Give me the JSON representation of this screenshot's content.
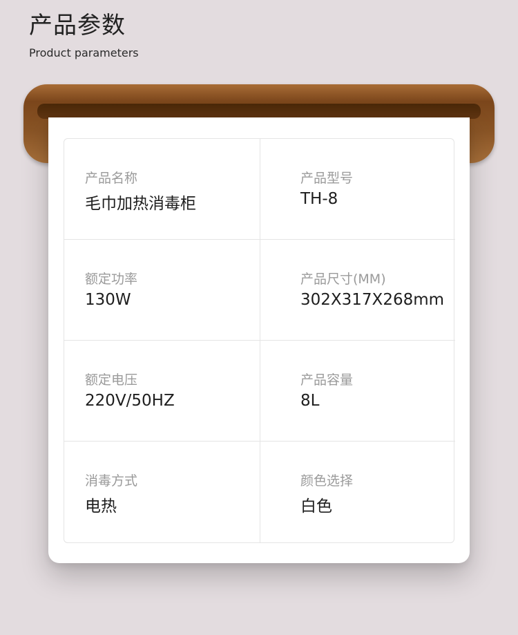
{
  "header": {
    "title_cn": "产品参数",
    "title_en": "Product parameters"
  },
  "params": [
    {
      "label": "产品名称",
      "value": "毛巾加热消毒柜"
    },
    {
      "label": "产品型号",
      "value": "TH-8"
    },
    {
      "label": "额定功率",
      "value": "130W"
    },
    {
      "label": "产品尺寸(MM)",
      "value": "302X317X268mm"
    },
    {
      "label": "额定电压",
      "value": "220V/50HZ"
    },
    {
      "label": "产品容量",
      "value": "8L"
    },
    {
      "label": "消毒方式",
      "value": "电热"
    },
    {
      "label": "颜色选择",
      "value": "白色"
    }
  ],
  "colors": {
    "background": "#e3dcdf",
    "rail_wood": "#8a5526",
    "paper": "#ffffff",
    "label_text": "#9a9a9a",
    "value_text": "#1e1e1e"
  }
}
